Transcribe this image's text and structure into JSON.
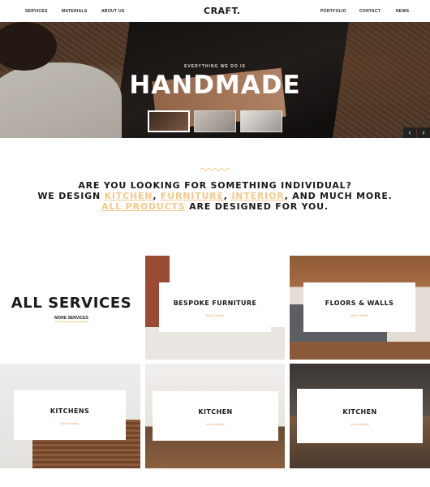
{
  "nav": {
    "left_items": [
      "SERVICES",
      "MATERIALS",
      "ABOUT US"
    ],
    "logo": "CRAFT.",
    "right_items": [
      "PORTFOLIO",
      "CONTACT",
      "NEWS"
    ]
  },
  "hero": {
    "eyebrow": "EVERYTHING WE DO IS",
    "title": "HANDMADE",
    "thumbnail_count": 3,
    "active_thumbnail": 1,
    "prev_icon": "‹",
    "next_icon": "›"
  },
  "intro": {
    "line1": "ARE YOU LOOKING FOR SOMETHING INDIVIDUAL?",
    "line2_prefix": "WE DESIGN ",
    "kitchen": "KITCHEN",
    "furniture": "FURNITURE",
    "interior": "INTERIOR",
    "line2_suffix": ", AND MUCH MORE.",
    "all_products": "ALL PRODUCTS",
    "line3_suffix": " ARE DESIGNED FOR YOU.",
    "accent_color": "#f5c98b"
  },
  "services": {
    "title": "ALL SERVICES",
    "more_link": "MORE SERVICES",
    "tiles": [
      {
        "name": "BESPOKE FURNITURE",
        "more": "More Details"
      },
      {
        "name": "FLOORS & WALLS",
        "more": "More Details"
      },
      {
        "name": "KITCHENS",
        "more": "More Details"
      },
      {
        "name": "KITCHEN",
        "more": "More Details"
      },
      {
        "name": "KITCHEN",
        "more": "More Details"
      }
    ]
  }
}
